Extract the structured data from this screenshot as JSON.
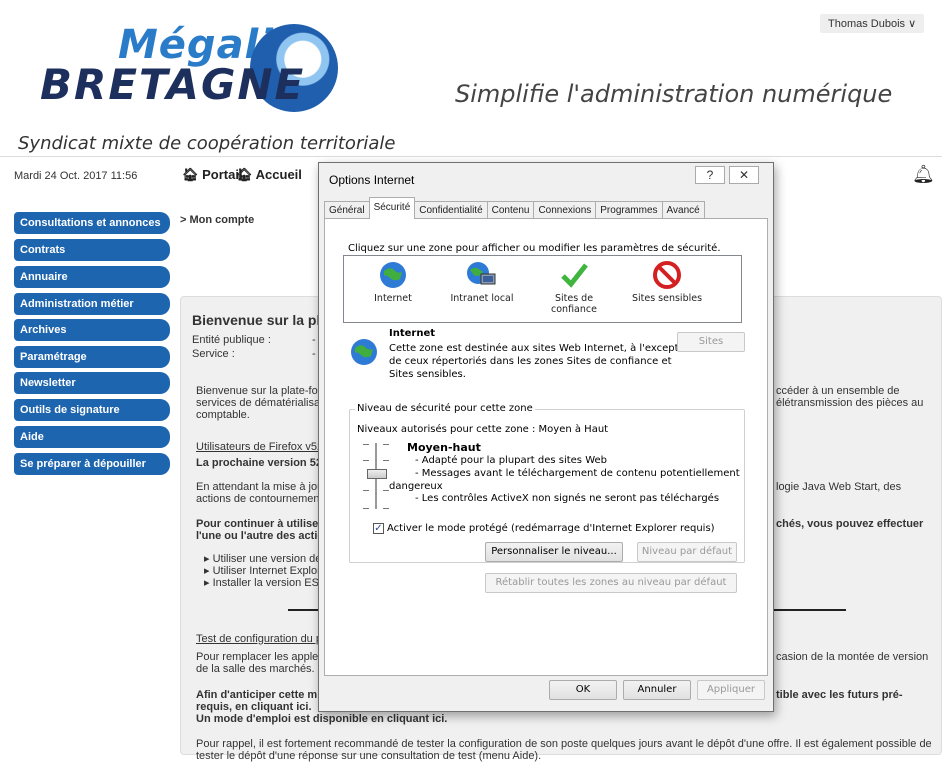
{
  "header": {
    "user": "Thomas Dubois ∨",
    "logo_top": "Mégalis",
    "logo_bottom": "BRETAGNE",
    "tagline": "Simplifie l'administration numérique",
    "syndicat": "Syndicat mixte de coopération territoriale",
    "date": "Mardi 24 Oct. 2017 11:56",
    "portail": "Portail",
    "accueil": "Accueil"
  },
  "sidebar": {
    "items": [
      {
        "label": "Consultations et annonces"
      },
      {
        "label": "Contrats"
      },
      {
        "label": "Annuaire"
      },
      {
        "label": "Administration métier"
      },
      {
        "label": "Archives"
      },
      {
        "label": "Paramétrage"
      },
      {
        "label": "Newsletter"
      },
      {
        "label": "Outils de signature"
      },
      {
        "label": "Aide"
      },
      {
        "label": "Se préparer à dépouiller"
      }
    ]
  },
  "main": {
    "breadcrumb": "> Mon compte",
    "welcome": "Bienvenue sur la plat",
    "entite": "Entité publique :",
    "entite_val": "- (",
    "service": "Service :",
    "service_val": "- (",
    "p1a": "Bienvenue sur la plate-form",
    "p1b": "services de dématérialisati",
    "p1c": "comptable.",
    "p1r1": "ccéder à un ensemble de",
    "p1r2": "élétransmission des pièces au",
    "ff_link": "Utilisateurs de Firefox v52",
    "ff_next": "La prochaine version 52",
    "p2a": "En attendant la mise à jou",
    "p2b": "actions de contournement",
    "p2r": "logie Java Web Start, des",
    "p3a": "Pour continuer à utiliser",
    "p3b": "l'une ou l'autre des actio",
    "p3r": "chés, vous pouvez effectuer",
    "li1": "▸  Utiliser une version de",
    "li2": "▸  Utiliser Internet Explor",
    "li3": "▸  Installer la version ES",
    "test_link": "Test de configuration du p",
    "p4a": "Pour remplacer les applets",
    "p4b": "de la salle des marchés.",
    "p4r": "casion de la montée de version",
    "p5a": "Afin d'anticiper cette mis",
    "p5b": "requis, en cliquant ici.",
    "p5c": "Un mode d'emploi est disponible en cliquant ici.",
    "p5r": "tible avec les futurs pré-",
    "p6": "Pour rappel, il est fortement recommandé de tester la configuration de son poste quelques jours avant le dépôt d'une offre. Il est également possible de",
    "p7": "tester le dépôt d'une réponse sur une consultation de test (menu Aide)."
  },
  "dialog": {
    "title": "Options Internet",
    "help": "?",
    "close": "✕",
    "tabs": [
      "Général",
      "Sécurité",
      "Confidentialité",
      "Contenu",
      "Connexions",
      "Programmes",
      "Avancé"
    ],
    "instruction": "Cliquez sur une zone pour afficher ou modifier les paramètres de sécurité.",
    "zones": [
      {
        "label": "Internet",
        "icon": "globe-icon"
      },
      {
        "label": "Intranet local",
        "icon": "intranet-icon"
      },
      {
        "label": "Sites de confiance",
        "icon": "checkmark-icon"
      },
      {
        "label": "Sites sensibles",
        "icon": "prohibited-icon"
      }
    ],
    "zone_name": "Internet",
    "zone_desc1": "Cette zone est destinée aux sites Web Internet, à l'exception",
    "zone_desc2": "de ceux répertoriés dans les zones Sites de confiance et",
    "zone_desc3": "Sites sensibles.",
    "sites_btn": "Sites",
    "level_group": "Niveau de sécurité pour cette zone",
    "allowed": "Niveaux autorisés pour cette zone : Moyen à Haut",
    "level_name": "Moyen-haut",
    "level_b1": "- Adapté pour la plupart des sites Web",
    "level_b2": "- Messages avant le téléchargement de contenu potentiellement",
    "level_b2b": "dangereux",
    "level_b3": "- Les contrôles ActiveX non signés ne seront pas téléchargés",
    "protected_mode": "Activer le mode protégé (redémarrage d'Internet Explorer requis)",
    "customize_btn": "Personnaliser le niveau...",
    "default_btn": "Niveau par défaut",
    "reset_all_btn": "Rétablir toutes les zones au niveau par défaut",
    "ok_btn": "OK",
    "cancel_btn": "Annuler",
    "apply_btn": "Appliquer"
  }
}
